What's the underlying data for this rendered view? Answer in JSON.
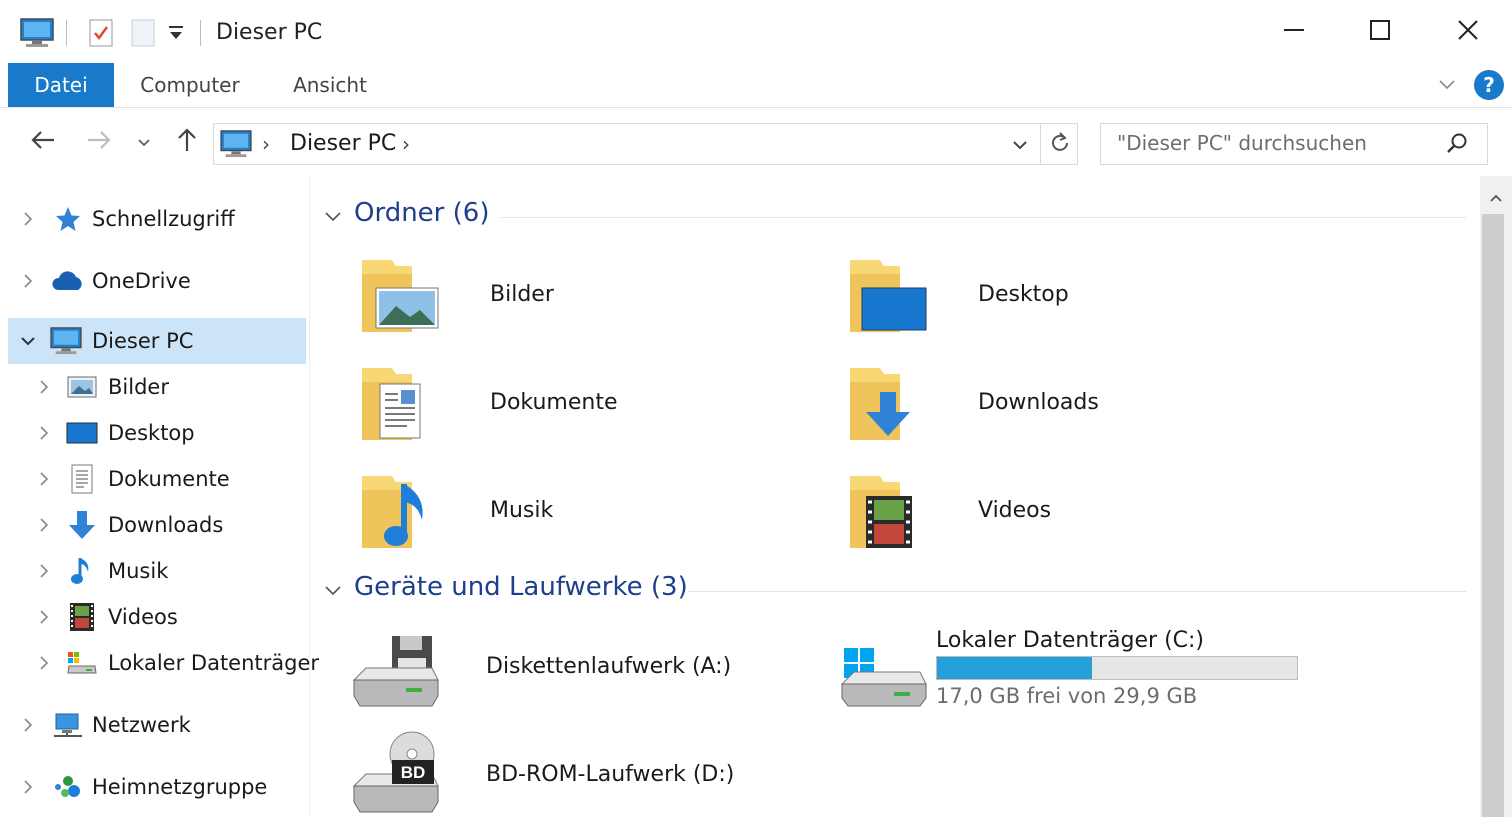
{
  "window": {
    "title": "Dieser PC",
    "controls": {
      "minimize": "minimize-icon",
      "maximize": "maximize-icon",
      "close": "close-icon"
    }
  },
  "ribbon": {
    "tabs": [
      {
        "label": "Datei",
        "active": true
      },
      {
        "label": "Computer",
        "active": false
      },
      {
        "label": "Ansicht",
        "active": false
      }
    ],
    "help_label": "?"
  },
  "address": {
    "crumbs": [
      "Dieser PC"
    ]
  },
  "search": {
    "placeholder": "\"Dieser PC\" durchsuchen"
  },
  "sidebar": {
    "items": [
      {
        "label": "Schnellzugriff",
        "icon": "star-icon",
        "level": 0,
        "expanded": false
      },
      {
        "label": "OneDrive",
        "icon": "onedrive-icon",
        "level": 0,
        "expanded": false
      },
      {
        "label": "Dieser PC",
        "icon": "computer-icon",
        "level": 0,
        "expanded": true,
        "selected": true
      },
      {
        "label": "Bilder",
        "icon": "pictures-icon",
        "level": 1,
        "expanded": false
      },
      {
        "label": "Desktop",
        "icon": "desktop-icon",
        "level": 1,
        "expanded": false
      },
      {
        "label": "Dokumente",
        "icon": "documents-icon",
        "level": 1,
        "expanded": false
      },
      {
        "label": "Downloads",
        "icon": "downloads-icon",
        "level": 1,
        "expanded": false
      },
      {
        "label": "Musik",
        "icon": "music-icon",
        "level": 1,
        "expanded": false
      },
      {
        "label": "Videos",
        "icon": "videos-icon",
        "level": 1,
        "expanded": false
      },
      {
        "label": "Lokaler Datenträger",
        "icon": "local-disk-icon",
        "level": 1,
        "expanded": false
      },
      {
        "label": "Netzwerk",
        "icon": "network-icon",
        "level": 0,
        "expanded": false
      },
      {
        "label": "Heimnetzgruppe",
        "icon": "homegroup-icon",
        "level": 0,
        "expanded": false
      }
    ]
  },
  "content": {
    "folders_group": "Ordner (6)",
    "folders": [
      {
        "label": "Bilder",
        "icon": "pictures-folder-icon"
      },
      {
        "label": "Desktop",
        "icon": "desktop-folder-icon"
      },
      {
        "label": "Dokumente",
        "icon": "documents-folder-icon"
      },
      {
        "label": "Downloads",
        "icon": "downloads-folder-icon"
      },
      {
        "label": "Musik",
        "icon": "music-folder-icon"
      },
      {
        "label": "Videos",
        "icon": "videos-folder-icon"
      }
    ],
    "devices_group": "Geräte und Laufwerke (3)",
    "devices": [
      {
        "label": "Diskettenlaufwerk (A:)",
        "icon": "floppy-drive-icon"
      },
      {
        "label": "Lokaler Datenträger (C:)",
        "icon": "system-drive-icon",
        "free_text": "17,0 GB frei von 29,9 GB",
        "used_fraction": 0.431
      },
      {
        "label": "BD-ROM-Laufwerk (D:)",
        "icon": "bd-rom-drive-icon",
        "badge": "BD"
      }
    ]
  },
  "colors": {
    "accent": "#1979ca",
    "selection": "#cce4f7",
    "group_heading": "#1e3f8c",
    "drive_bar": "#26a0da",
    "folder": "#f8d775"
  }
}
